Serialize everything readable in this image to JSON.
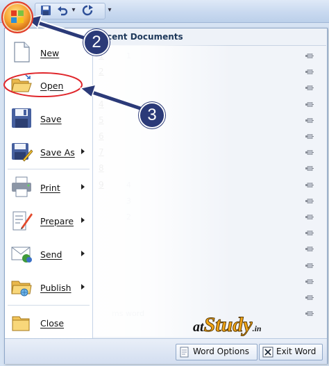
{
  "toolbar": {
    "icons": [
      "office-button-icon",
      "save-icon",
      "undo-icon",
      "redo-icon",
      "customize-dropdown-icon"
    ]
  },
  "menu": {
    "left_items": [
      {
        "id": "new",
        "label": "New",
        "icon": "new-document-icon",
        "submenu": false
      },
      {
        "id": "open",
        "label": "Open",
        "icon": "open-folder-icon",
        "submenu": false
      },
      {
        "id": "save",
        "label": "Save",
        "icon": "floppy-save-icon",
        "submenu": false
      },
      {
        "id": "save-as",
        "label": "Save As",
        "icon": "save-as-icon",
        "submenu": true
      },
      {
        "id": "print",
        "label": "Print",
        "icon": "printer-icon",
        "submenu": true
      },
      {
        "id": "prepare",
        "label": "Prepare",
        "icon": "prepare-document-icon",
        "submenu": true
      },
      {
        "id": "send",
        "label": "Send",
        "icon": "send-mail-icon",
        "submenu": true
      },
      {
        "id": "publish",
        "label": "Publish",
        "icon": "publish-folder-icon",
        "submenu": true
      },
      {
        "id": "close",
        "label": "Close",
        "icon": "close-folder-icon",
        "submenu": false
      }
    ],
    "recent": {
      "title": "cent Documents",
      "documents": [
        {
          "num": "1",
          "name": "1"
        },
        {
          "num": "2",
          "name": ""
        },
        {
          "num": "",
          "name": ""
        },
        {
          "num": "4",
          "name": ""
        },
        {
          "num": "5",
          "name": ""
        },
        {
          "num": "6",
          "name": ""
        },
        {
          "num": "7",
          "name": ""
        },
        {
          "num": "8",
          "name": ""
        },
        {
          "num": "9",
          "name": "4"
        },
        {
          "num": "",
          "name": "3"
        },
        {
          "num": "",
          "name": "2"
        },
        {
          "num": "",
          "name": ""
        },
        {
          "num": "",
          "name": ""
        },
        {
          "num": "",
          "name": ""
        },
        {
          "num": "",
          "name": ""
        },
        {
          "num": "",
          "name": ""
        },
        {
          "num": "",
          "name": "ms word"
        }
      ]
    },
    "buttons": {
      "word_options": "Word Options",
      "exit_word": "Exit Word"
    }
  },
  "annotations": {
    "callout_2": "2",
    "callout_3": "3",
    "arrow_color": "#2b3a78",
    "highlight_color": "#e0262b"
  },
  "watermark": {
    "at": "at",
    "study": "Study",
    "in": ".in"
  }
}
